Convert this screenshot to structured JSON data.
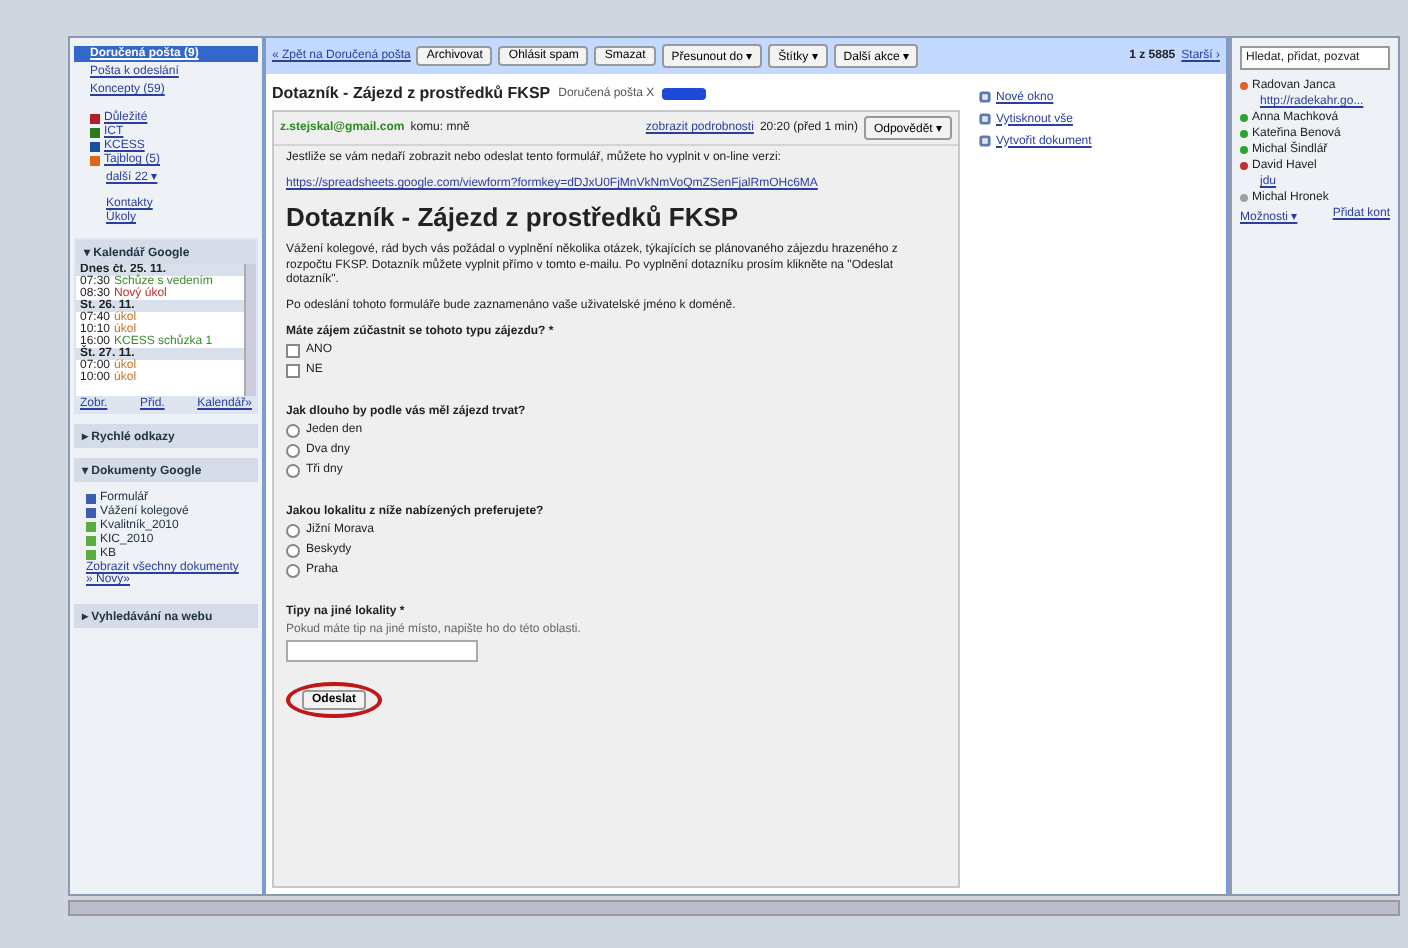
{
  "sidebar": {
    "nav": [
      {
        "label": "Doručená pošta (9)",
        "selected": true
      },
      {
        "label": "Pošta k odeslání",
        "selected": false
      },
      {
        "label": "Koncepty (59)",
        "selected": false
      }
    ],
    "labels": [
      {
        "name": "Důležité",
        "color": "#b0202a"
      },
      {
        "name": "ICT",
        "color": "#2a7a20"
      },
      {
        "name": "KCESS",
        "color": "#1a4f9a"
      },
      {
        "name": "Tajblog (5)",
        "color": "#e0641a"
      }
    ],
    "more_labels": "další 22 ▾",
    "links": [
      "Kontakty",
      "Úkoly"
    ],
    "calendar": {
      "title": "▾ Kalendář Google",
      "days": [
        {
          "heading": "Dnes čt. 25. 11.",
          "events": [
            {
              "time": "07:30",
              "title": "Schůze s vedením",
              "color": "#3a8a2a"
            },
            {
              "time": "08:30",
              "title": "Nový úkol",
              "color": "#c03030"
            }
          ]
        },
        {
          "heading": "St. 26. 11.",
          "events": [
            {
              "time": "07:40",
              "title": "úkol",
              "color": "#d07020"
            },
            {
              "time": "10:10",
              "title": "úkol",
              "color": "#d07020"
            },
            {
              "time": "16:00",
              "title": "KCESS schůzka 1",
              "color": "#3a8a2a"
            }
          ]
        },
        {
          "heading": "Št. 27. 11.",
          "events": [
            {
              "time": "07:00",
              "title": "úkol",
              "color": "#d07020"
            },
            {
              "time": "10:00",
              "title": "úkol",
              "color": "#d07020"
            }
          ]
        }
      ],
      "footer": [
        "Zobr.",
        "Přid.",
        "Kalendář»"
      ]
    },
    "quick_links": "▸ Rychlé odkazy",
    "docs": {
      "title": "▾ Dokumenty Google",
      "items": [
        {
          "name": "Formulář",
          "kind": "document"
        },
        {
          "name": "Vážení kolegové",
          "kind": "document"
        },
        {
          "name": "Kvalitník_2010",
          "kind": "spreadsheet"
        },
        {
          "name": "KIC_2010",
          "kind": "spreadsheet"
        },
        {
          "name": "KB",
          "kind": "spreadsheet"
        }
      ],
      "footer": "Zobrazit všechny dokumenty » Nový»"
    },
    "web_search": "▸ Vyhledávání na webu"
  },
  "toolbar": {
    "back": "« Zpět na Doručená pošta",
    "buttons": [
      "Archivovat",
      "Ohlásit spam",
      "Smazat"
    ],
    "menus": [
      "Přesunout do ▾",
      "Štítky ▾",
      "Další akce ▾"
    ],
    "count": "1 z 5885",
    "older": "Starší ›"
  },
  "message": {
    "subject": "Dotazník - Zájezd z prostředků FKSP",
    "tag": "Doručená pošta X",
    "sender": "z.stejskal@gmail.com",
    "recipient": "komu: mně",
    "details": "zobrazit podrobnosti",
    "time": "20:20 (před 1 min)",
    "reply": "Odpovědět ▾",
    "intro": "Jestliže se vám nedaří zobrazit nebo odeslat tento formulář, můžete ho vyplnit v on-line verzi:",
    "link": "https://spreadsheets.google.com/viewform?formkey=dDJxU0FjMnVkNmVoQmZSenFjalRmOHc6MA",
    "form": {
      "title": "Dotazník - Zájezd z prostředků FKSP",
      "description": "Vážení kolegové, rád bych vás požádal o vyplnění několika otázek, týkajících se plánovaného zájezdu hrazeného z rozpočtu FKSP. Dotazník můžete vyplnit přímo v tomto e-mailu. Po vyplnění dotazníku prosím klikněte na \"Odeslat dotazník\".",
      "notice": "Po odeslání tohoto formuláře bude zaznamenáno vaše uživatelské jméno k doméně.",
      "questions": [
        {
          "kind": "checkbox",
          "text": "Máte zájem zúčastnit se tohoto typu zájezdu? *",
          "options": [
            {
              "label": "ANO",
              "checked": false
            },
            {
              "label": "NE",
              "checked": false
            }
          ]
        },
        {
          "kind": "radio",
          "text": "Jak dlouho by podle vás měl zájezd trvat?",
          "options": [
            {
              "label": "Jeden den",
              "selected": false
            },
            {
              "label": "Dva dny",
              "selected": false
            },
            {
              "label": "Tři dny",
              "selected": false
            }
          ]
        },
        {
          "kind": "radio",
          "text": "Jakou lokalitu z níže nabízených preferujete?",
          "options": [
            {
              "label": "Jižní Morava",
              "selected": false
            },
            {
              "label": "Beskydy",
              "selected": false
            },
            {
              "label": "Praha",
              "selected": false
            }
          ]
        },
        {
          "kind": "text",
          "text": "Tipy na jiné lokality *",
          "help": "Pokud máte tip na jiné místo, napište ho do této oblasti."
        }
      ],
      "submit": "Odeslat"
    }
  },
  "actions": [
    "Nové okno",
    "Vytisknout vše",
    "Vytvořit dokument"
  ],
  "chat": {
    "search": "Hledat, přidat, pozvat",
    "contacts": [
      {
        "name": "Radovan Janca",
        "color": "#e06030",
        "status": "http://radekahr.go..."
      },
      {
        "name": "Anna Machková",
        "color": "#30a030"
      },
      {
        "name": "Kateřina Benová",
        "color": "#30a030"
      },
      {
        "name": "Michal Šindlář",
        "color": "#30a030"
      },
      {
        "name": "David Havel",
        "color": "#c03030",
        "status": "jdu"
      },
      {
        "name": "Michal Hronek",
        "color": "#a0a0a0"
      }
    ],
    "options": "Možnosti ▾",
    "add": "Přidat kont"
  }
}
